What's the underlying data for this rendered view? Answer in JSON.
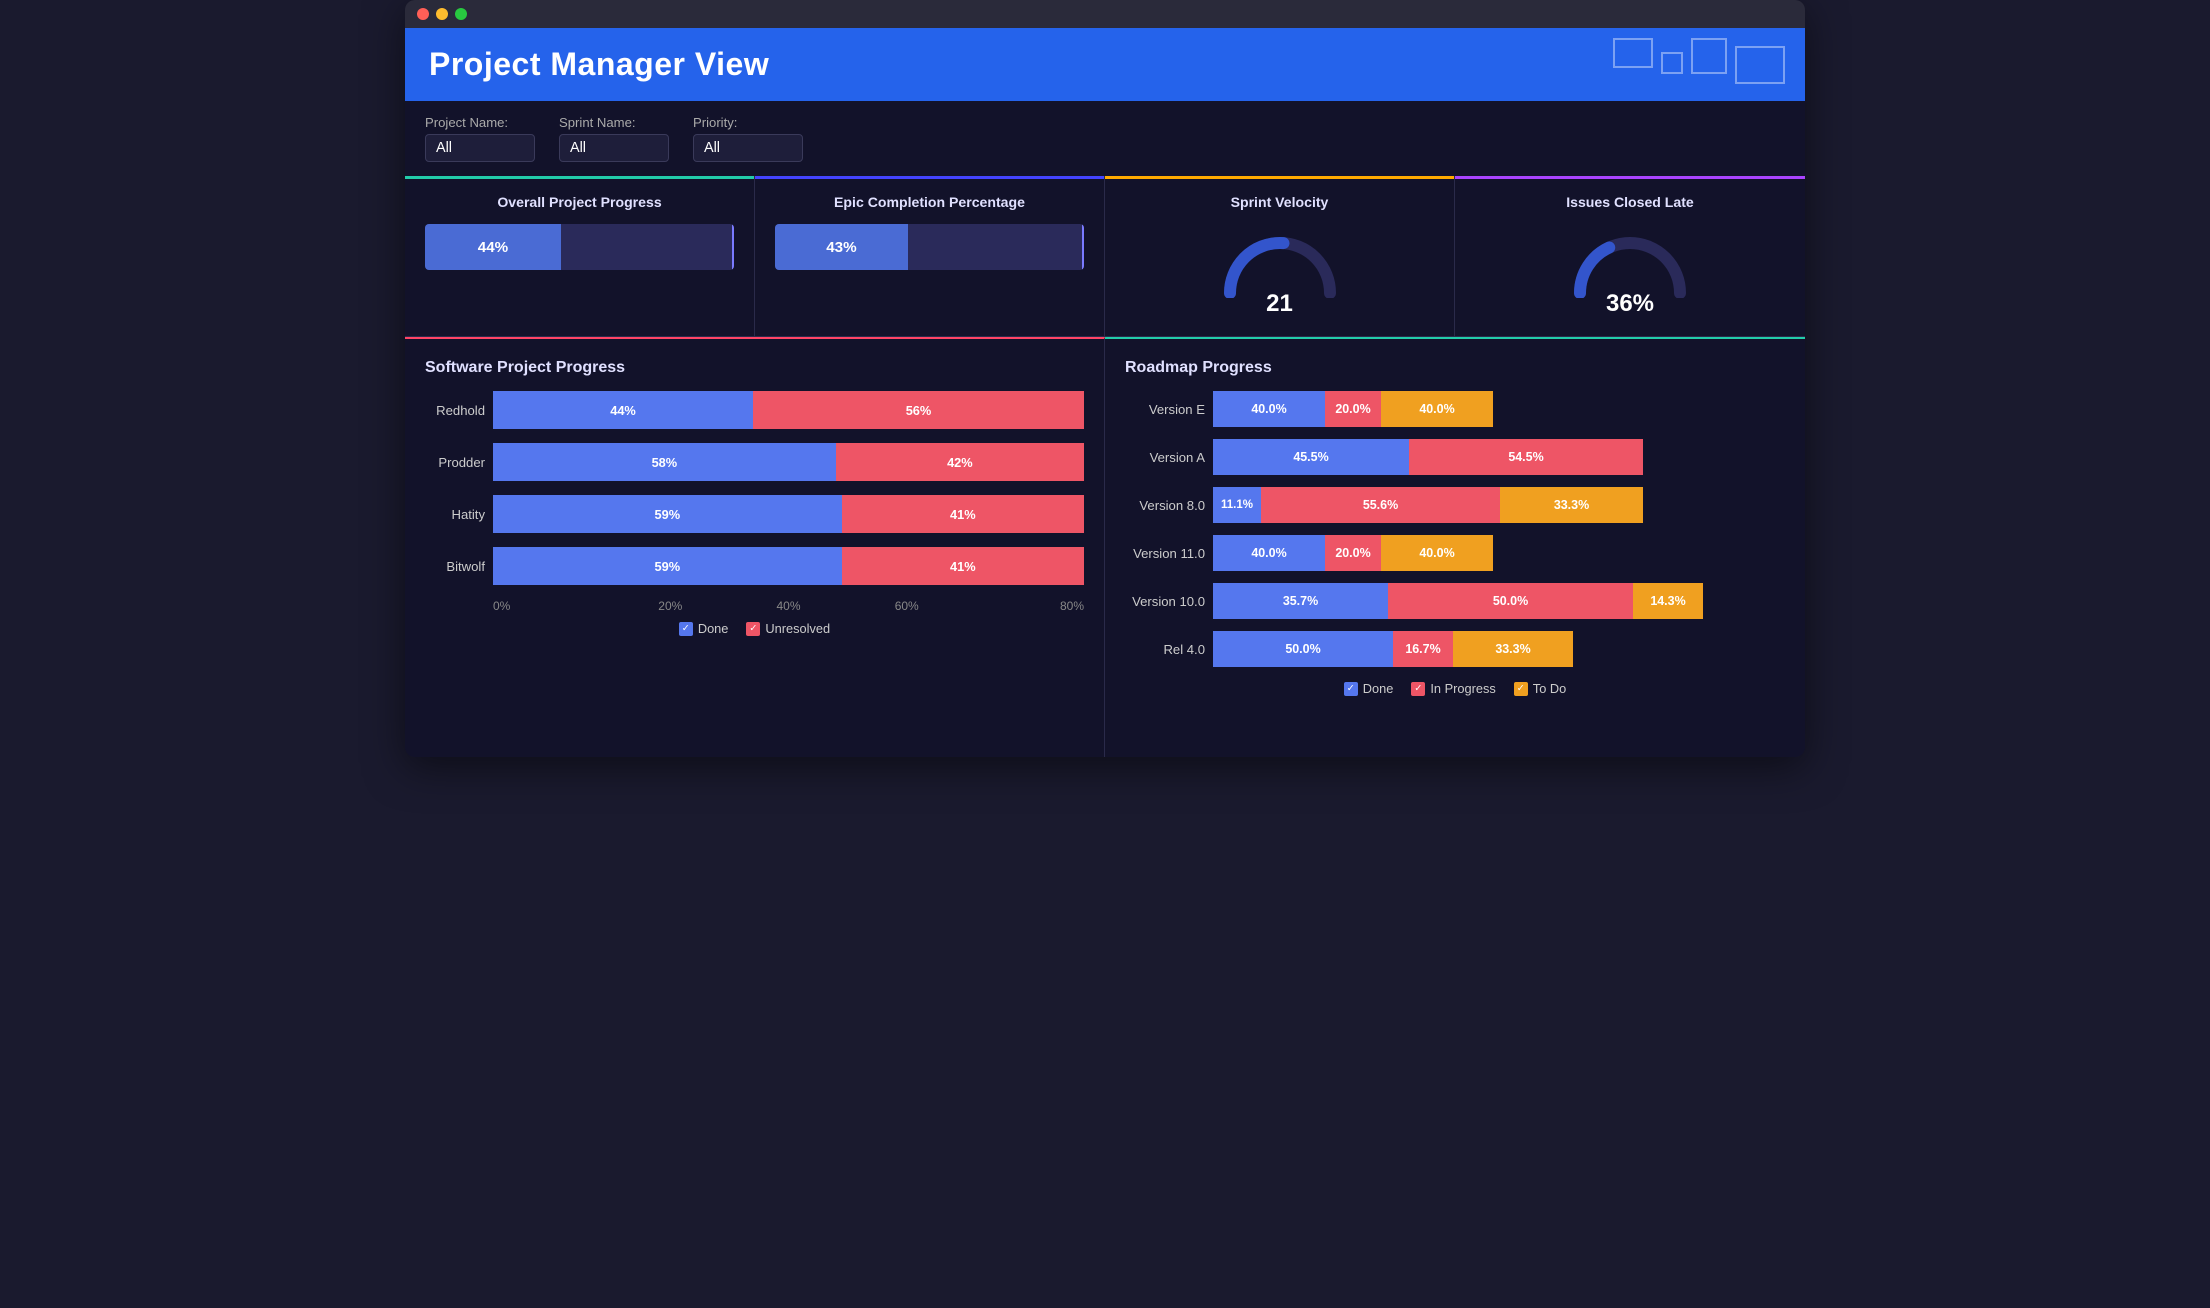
{
  "app": {
    "title": "Project Manager View"
  },
  "filters": {
    "project_name_label": "Project Name:",
    "project_name_options": [
      "All"
    ],
    "project_name_value": "All",
    "sprint_name_label": "Sprint Name:",
    "sprint_name_options": [
      "All"
    ],
    "sprint_name_value": "All",
    "priority_label": "Priority:",
    "priority_options": [
      "All"
    ],
    "priority_value": "All"
  },
  "kpis": {
    "overall_progress": {
      "title": "Overall Project Progress",
      "value": 44,
      "label": "44%",
      "border_color": "#22ccaa"
    },
    "epic_completion": {
      "title": "Epic Completion Percentage",
      "value": 43,
      "label": "43%",
      "border_color": "#4444ff"
    },
    "sprint_velocity": {
      "title": "Sprint Velocity",
      "value": 21,
      "label": "21",
      "border_color": "#ffaa00"
    },
    "issues_closed_late": {
      "title": "Issues Closed Late",
      "value": 36,
      "label": "36%",
      "border_color": "#aa44ff"
    }
  },
  "software_progress": {
    "title": "Software Project Progress",
    "bars": [
      {
        "label": "Redhold",
        "done": 44,
        "unresolved": 56
      },
      {
        "label": "Prodder",
        "done": 58,
        "unresolved": 42
      },
      {
        "label": "Hatity",
        "done": 59,
        "unresolved": 41
      },
      {
        "label": "Bitwolf",
        "done": 59,
        "unresolved": 41
      }
    ],
    "axis_ticks": [
      "0%",
      "20%",
      "40%",
      "60%",
      "80%"
    ],
    "legend": [
      {
        "key": "done",
        "label": "Done",
        "color": "#5577ee"
      },
      {
        "key": "unresolved",
        "label": "Unresolved",
        "color": "#ee5566"
      }
    ]
  },
  "roadmap_progress": {
    "title": "Roadmap Progress",
    "bars": [
      {
        "label": "Version E",
        "done": 40.0,
        "inprogress": 20.0,
        "todo": 40.0
      },
      {
        "label": "Version A",
        "done": 45.5,
        "inprogress": 54.5,
        "todo": 0
      },
      {
        "label": "Version 8.0",
        "done": 11.1,
        "inprogress": 55.6,
        "todo": 33.3
      },
      {
        "label": "Version 11.0",
        "done": 40.0,
        "inprogress": 20.0,
        "todo": 40.0
      },
      {
        "label": "Version 10.0",
        "done": 35.7,
        "inprogress": 50.0,
        "todo": 14.3
      },
      {
        "label": "Rel 4.0",
        "done": 50.0,
        "inprogress": 16.7,
        "todo": 33.3
      }
    ],
    "legend": [
      {
        "key": "done",
        "label": "Done",
        "color": "#5577ee"
      },
      {
        "key": "inprogress",
        "label": "In Progress",
        "color": "#ee5566"
      },
      {
        "key": "todo",
        "label": "To Do",
        "color": "#f0a020"
      }
    ]
  }
}
